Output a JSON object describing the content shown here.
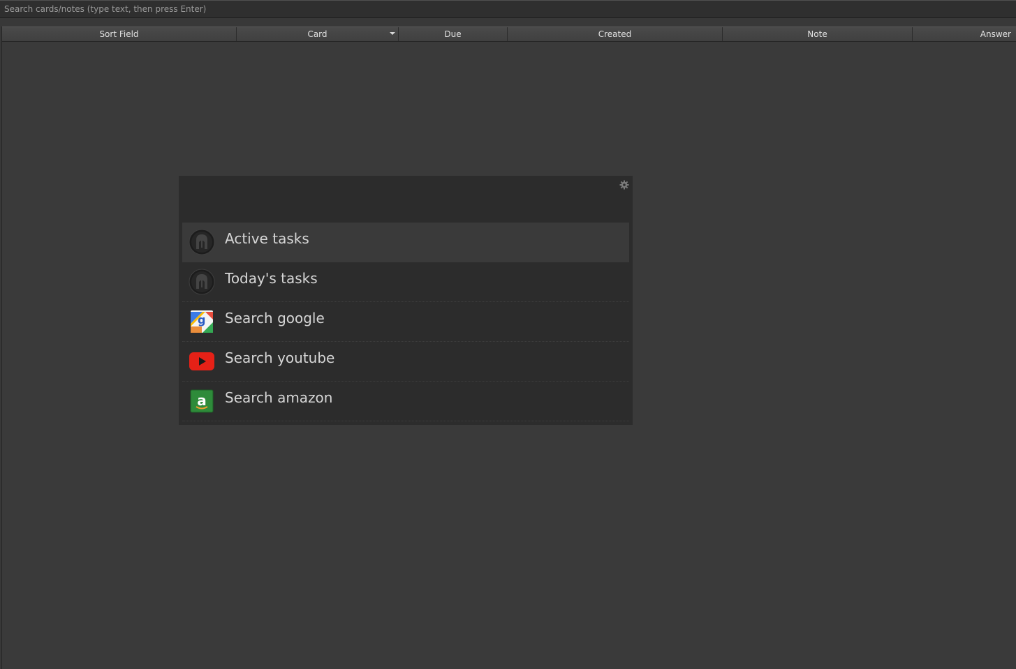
{
  "search": {
    "placeholder": "Search cards/notes (type text, then press Enter)",
    "value": ""
  },
  "table": {
    "columns": [
      {
        "label": "Sort Field"
      },
      {
        "label": "Card",
        "sorted": true
      },
      {
        "label": "Due"
      },
      {
        "label": "Created"
      },
      {
        "label": "Note"
      },
      {
        "label": "Answer"
      }
    ]
  },
  "launcher": {
    "settings_icon": "gear-icon",
    "items": [
      {
        "label": "Active tasks",
        "icon": "spartan-helmet-icon",
        "selected": true
      },
      {
        "label": "Today's tasks",
        "icon": "spartan-helmet-icon"
      },
      {
        "label": "Search google",
        "icon": "google-maps-icon"
      },
      {
        "label": "Search youtube",
        "icon": "youtube-icon"
      },
      {
        "label": "Search amazon",
        "icon": "amazon-icon"
      }
    ]
  },
  "colors": {
    "background": "#383838",
    "panel": "#2c2c2c",
    "selected_row": "#3a3a3a",
    "youtube_red": "#e62117",
    "amazon_green": "#2e8b3a"
  }
}
